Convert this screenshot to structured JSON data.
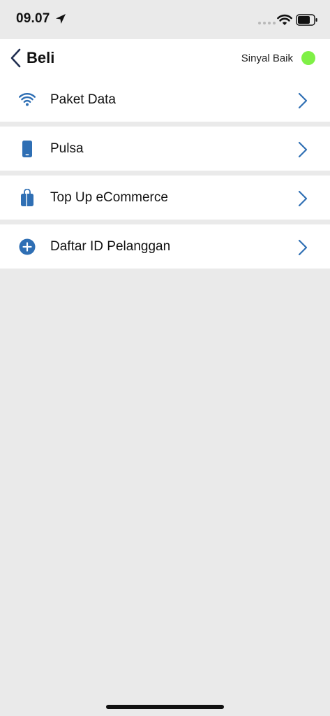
{
  "status_bar": {
    "time": "09.07"
  },
  "nav": {
    "title": "Beli",
    "signal_text": "Sinyal Baik",
    "signal_color": "#7ff046"
  },
  "menu": {
    "accent_color": "#2f6fb4",
    "items": [
      {
        "label": "Paket Data",
        "icon": "wifi-icon"
      },
      {
        "label": "Pulsa",
        "icon": "phone-icon"
      },
      {
        "label": "Top Up eCommerce",
        "icon": "shopping-bag-icon"
      },
      {
        "label": "Daftar ID Pelanggan",
        "icon": "plus-circle-icon"
      }
    ]
  }
}
